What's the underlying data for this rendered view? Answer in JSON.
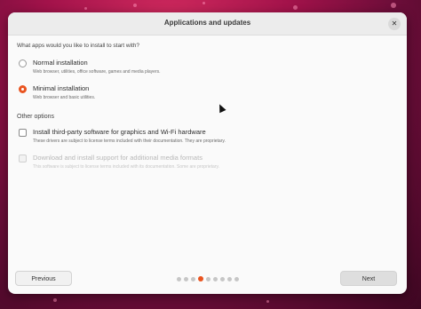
{
  "window": {
    "title": "Applications and updates",
    "close_icon": "close-icon"
  },
  "content": {
    "question": "What apps would you like to install to start with?",
    "options": [
      {
        "label": "Normal installation",
        "description": "Web browser, utilities, office software, games and media players.",
        "selected": false
      },
      {
        "label": "Minimal installation",
        "description": "Web browser and basic utilities.",
        "selected": true
      }
    ],
    "other_options_title": "Other options",
    "checkboxes": [
      {
        "label": "Install third-party software for graphics and Wi-Fi hardware",
        "description": "These drivers are subject to license terms included with their documentation. They are proprietary.",
        "checked": false,
        "enabled": true
      },
      {
        "label": "Download and install support for additional media formats",
        "description": "This software is subject to license terms included with its documentation. Some are proprietary.",
        "checked": false,
        "enabled": false
      }
    ]
  },
  "footer": {
    "previous_label": "Previous",
    "next_label": "Next",
    "pager": {
      "total": 9,
      "active_index": 3
    }
  },
  "colors": {
    "accent": "#e95420",
    "wallpaper": "#a2124a"
  }
}
